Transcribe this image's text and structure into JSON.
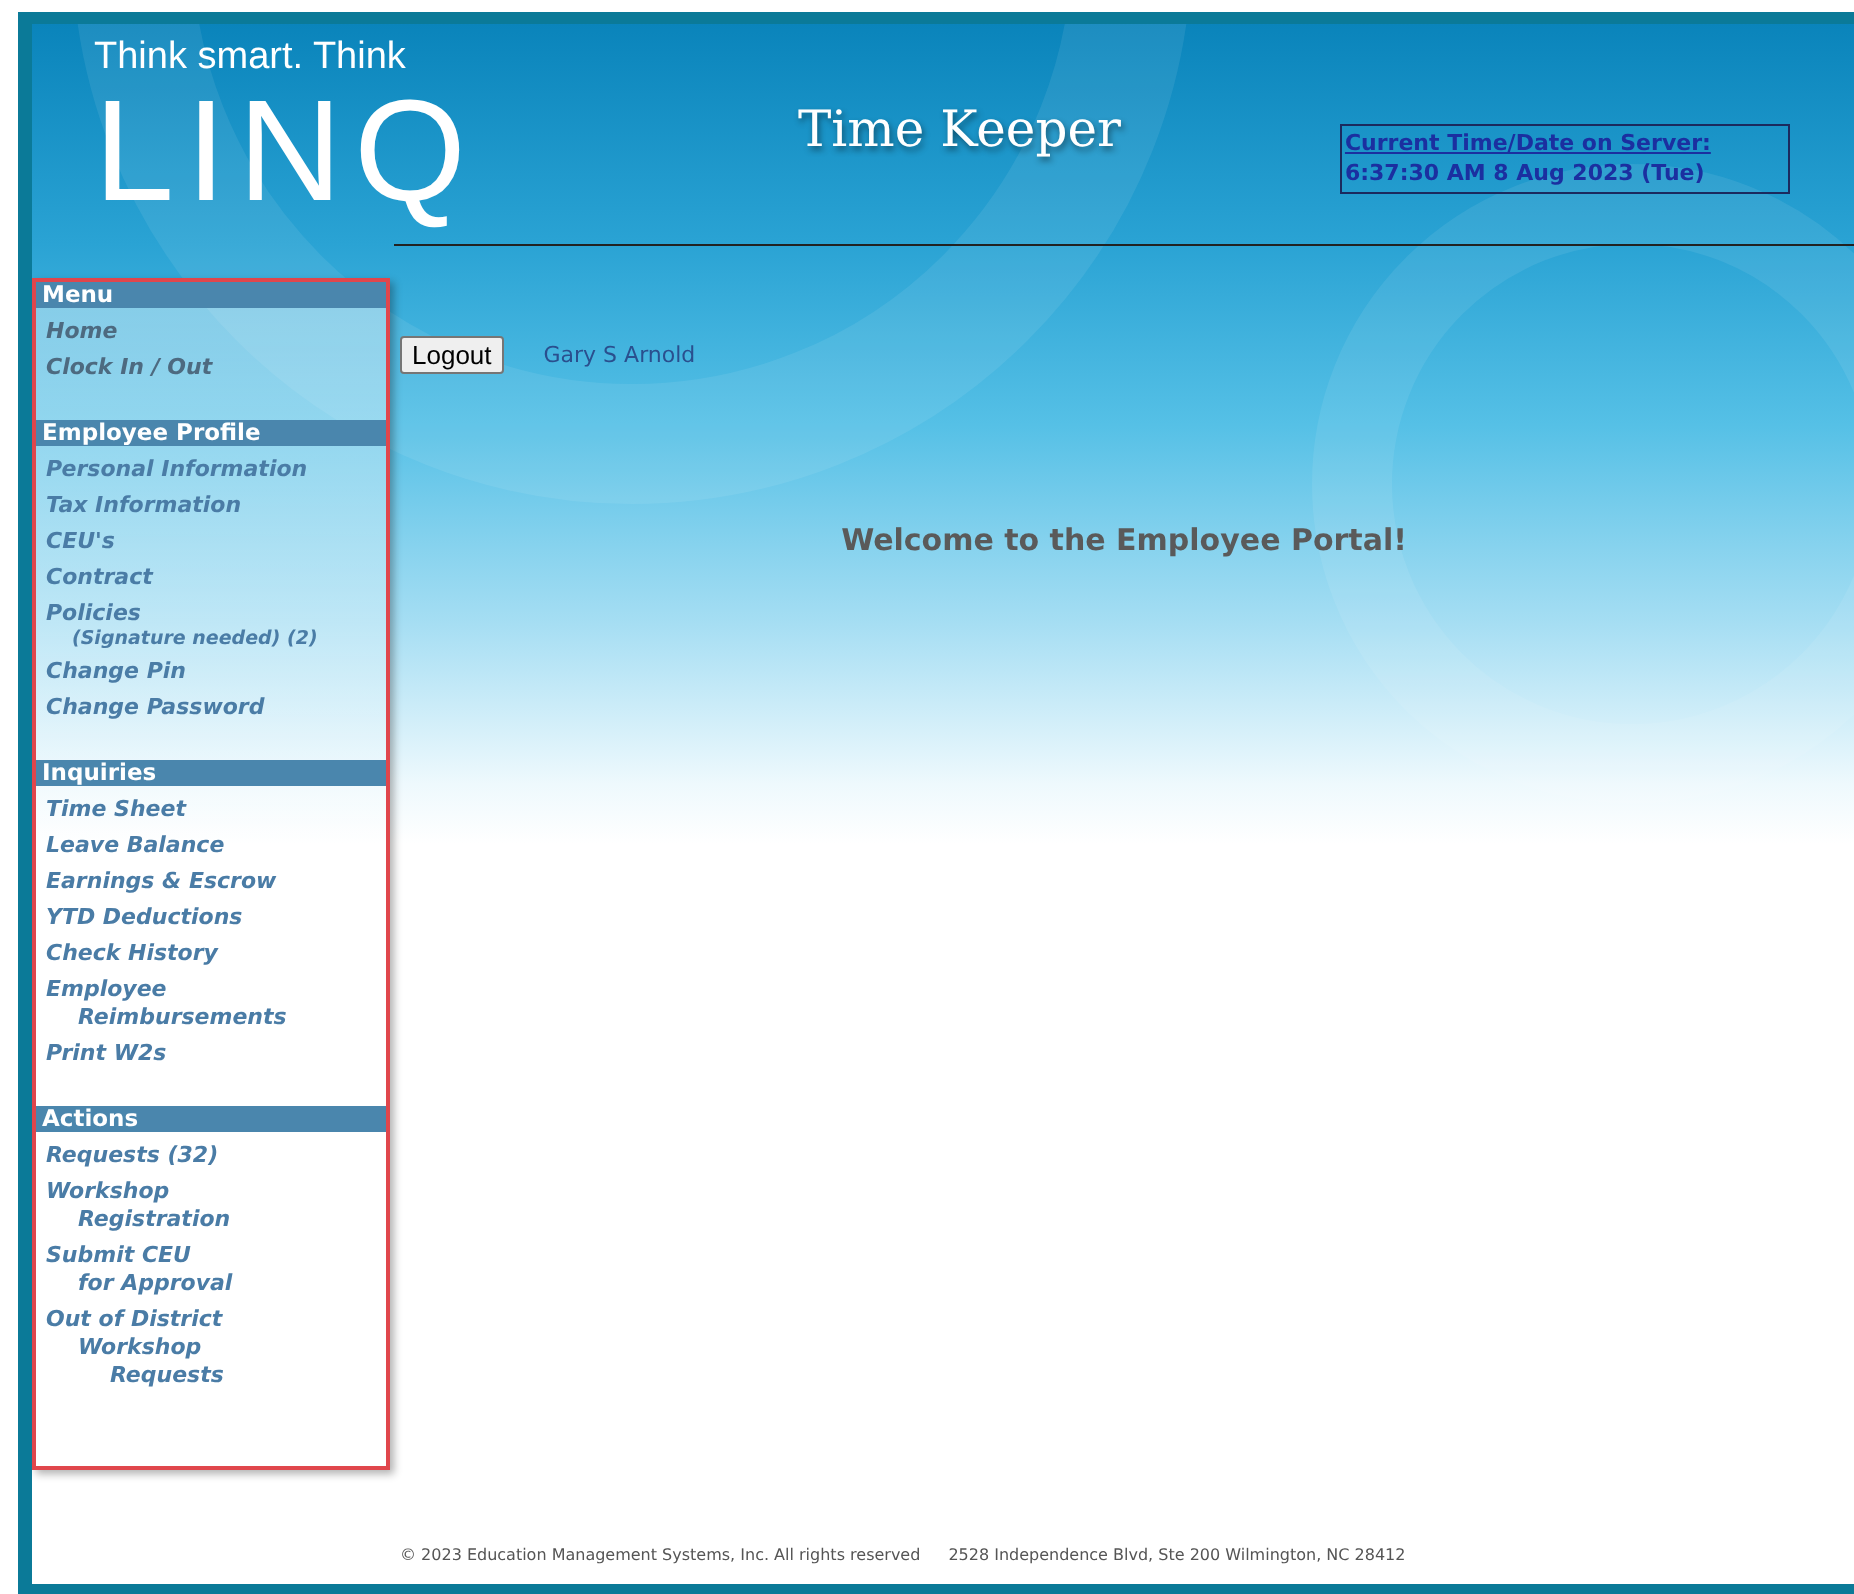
{
  "header": {
    "tagline": "Think smart. Think",
    "logo": "LINQ",
    "title": "Time Keeper",
    "server_time": {
      "label": "Current Time/Date on Server:",
      "value": "6:37:30 AM 8 Aug 2023 (Tue)"
    }
  },
  "sidebar": {
    "sections": [
      {
        "title": "Menu",
        "items": [
          {
            "lines": [
              "Home"
            ],
            "disabled": true
          },
          {
            "lines": [
              "Clock In  / Out"
            ],
            "disabled": true
          }
        ]
      },
      {
        "title": "Employee Profile",
        "items": [
          {
            "lines": [
              "Personal Information"
            ],
            "disabled": false
          },
          {
            "lines": [
              "Tax Information"
            ],
            "disabled": false
          },
          {
            "lines": [
              "CEU's"
            ],
            "disabled": false
          },
          {
            "lines": [
              "Contract"
            ],
            "disabled": false
          },
          {
            "lines": [
              "Policies"
            ],
            "note": "(Signature needed) (2)",
            "disabled": false
          },
          {
            "lines": [
              "Change Pin"
            ],
            "disabled": false
          },
          {
            "lines": [
              "Change Password"
            ],
            "disabled": false
          }
        ]
      },
      {
        "title": "Inquiries",
        "items": [
          {
            "lines": [
              "Time Sheet"
            ],
            "disabled": false
          },
          {
            "lines": [
              "Leave Balance"
            ],
            "disabled": false
          },
          {
            "lines": [
              "Earnings & Escrow"
            ],
            "disabled": false
          },
          {
            "lines": [
              "YTD Deductions"
            ],
            "disabled": false
          },
          {
            "lines": [
              "Check History"
            ],
            "disabled": false
          },
          {
            "lines": [
              "Employee",
              "Reimbursements"
            ],
            "disabled": false
          },
          {
            "lines": [
              "Print W2s"
            ],
            "disabled": false
          }
        ]
      },
      {
        "title": "Actions",
        "items": [
          {
            "lines": [
              "Requests (32)"
            ],
            "disabled": false
          },
          {
            "lines": [
              "Workshop",
              "Registration"
            ],
            "disabled": false
          },
          {
            "lines": [
              "Submit CEU",
              "for Approval"
            ],
            "disabled": false
          },
          {
            "lines": [
              "Out of District",
              "Workshop",
              "Requests"
            ],
            "disabled": false
          }
        ]
      }
    ]
  },
  "main": {
    "logout_button": "Logout",
    "user_name": "Gary S Arnold",
    "welcome": "Welcome to the Employee Portal!"
  },
  "footer": {
    "copyright": "© 2023 Education Management Systems, Inc. All rights reserved",
    "address": "2528 Independence Blvd, Ste 200 Wilmington, NC 28412"
  }
}
